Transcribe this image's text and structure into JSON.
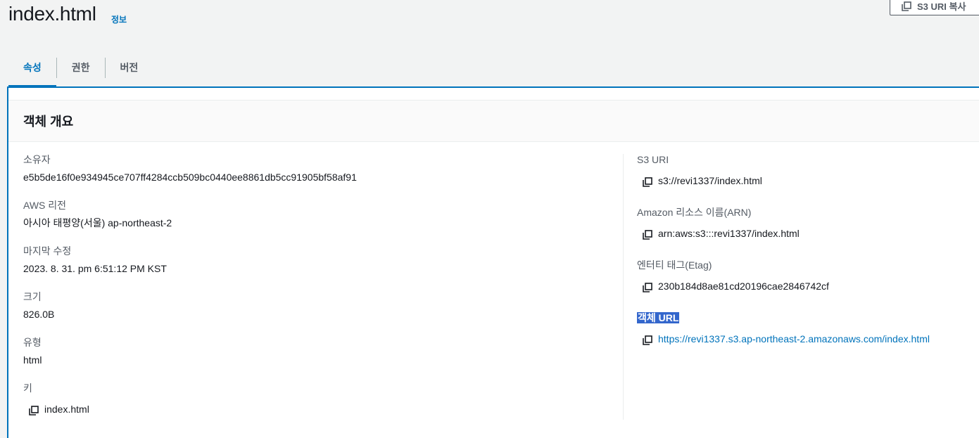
{
  "header": {
    "title": "index.html",
    "info_label": "정보",
    "copy_uri_button": "S3 URI 복사"
  },
  "tabs": [
    {
      "label": "속성",
      "active": true
    },
    {
      "label": "권한",
      "active": false
    },
    {
      "label": "버전",
      "active": false
    }
  ],
  "overview": {
    "title": "객체 개요",
    "left": {
      "owner": {
        "label": "소유자",
        "value": "e5b5de16f0e934945ce707ff4284ccb509bc0440ee8861db5cc91905bf58af91"
      },
      "region": {
        "label": "AWS 리전",
        "value": "아시아 태평양(서울) ap-northeast-2"
      },
      "last_modified": {
        "label": "마지막 수정",
        "value": "2023. 8. 31. pm 6:51:12 PM KST"
      },
      "size": {
        "label": "크기",
        "value": "826.0B"
      },
      "type": {
        "label": "유형",
        "value": "html"
      },
      "key": {
        "label": "키",
        "value": "index.html"
      }
    },
    "right": {
      "s3_uri": {
        "label": "S3 URI",
        "value": "s3://revi1337/index.html"
      },
      "arn": {
        "label": "Amazon 리소스 이름(ARN)",
        "value": "arn:aws:s3:::revi1337/index.html"
      },
      "etag": {
        "label": "엔터티 태그(Etag)",
        "value": "230b184d8ae81cd20196cae2846742cf"
      },
      "object_url": {
        "label": "객체 URL",
        "value": "https://revi1337.s3.ap-northeast-2.amazonaws.com/index.html"
      }
    }
  },
  "colors": {
    "accent": "#0073bb",
    "selection": "#3366cc",
    "background": "#f2f3f3"
  },
  "icons": {
    "copy": "copy-icon"
  }
}
